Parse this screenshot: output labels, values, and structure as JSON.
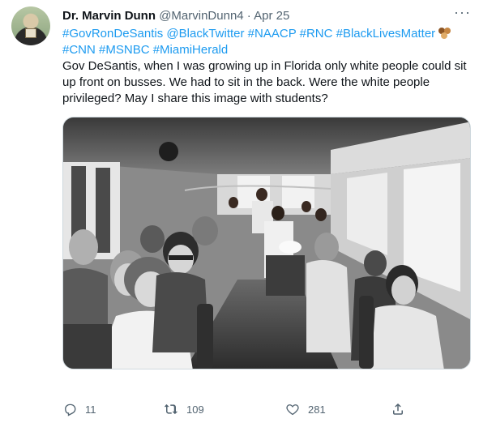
{
  "tweet": {
    "author_name": "Dr. Marvin Dunn",
    "handle": "@MarvinDunn4",
    "separator": "·",
    "date": "Apr 25",
    "more_icon": "ellipsis-icon",
    "hashtags_line1": [
      "#GovRonDeSantis",
      "@BlackTwitter",
      "#NAACP",
      "#RNC",
      "#BlackLivesMatter"
    ],
    "hashtags_line2": [
      "#CNN",
      "#MSNBC",
      "#MiamiHerald"
    ],
    "text": "Gov DeSantis, when I was growing up in Florida only white people could sit up front on busses. We had to sit in the back. Were the white people privileged? May I share this image with students?",
    "media_description": "black-and-white photograph of a segregated bus interior"
  },
  "actions": {
    "reply_count": "11",
    "retweet_count": "109",
    "like_count": "281",
    "reply_icon": "reply-icon",
    "retweet_icon": "retweet-icon",
    "like_icon": "heart-icon",
    "share_icon": "share-icon"
  },
  "colors": {
    "link": "#1d9bf0",
    "secondary_text": "#536471",
    "primary_text": "#0f1419",
    "border": "#cfd9de"
  }
}
